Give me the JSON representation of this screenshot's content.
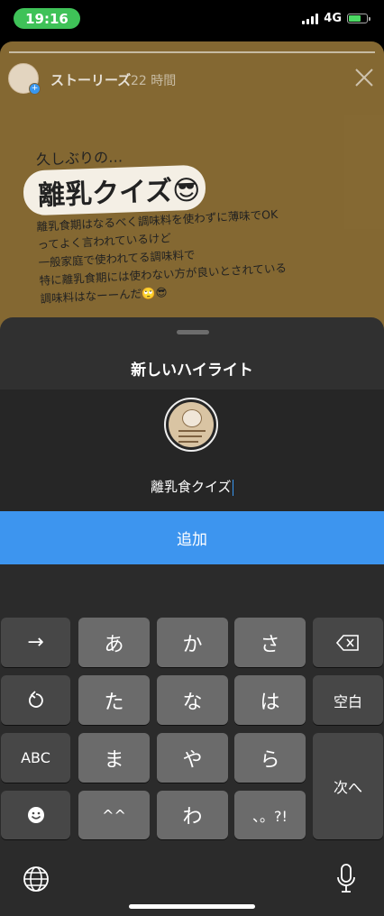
{
  "status_bar": {
    "time": "19:16",
    "network": "4G"
  },
  "story": {
    "username": "ストーリーズ",
    "time_ago": "22 時間",
    "intro": "久しぶりの…",
    "headline": "離乳クイズ😎",
    "body_lines": [
      "離乳食期はなるべく調味料を使わずに薄味でOK",
      "ってよく言われているけど",
      "一般家庭で使われてる調味料で",
      "特に離乳食期には使わない方が良いとされている",
      "調味料はなーーんだ🙄😎"
    ]
  },
  "sheet": {
    "title": "新しいハイライト",
    "name_value": "離乳食クイズ",
    "add_label": "追加"
  },
  "keyboard": {
    "row1": [
      "→",
      "あ",
      "か",
      "さ",
      "⌫"
    ],
    "row2": [
      "↺",
      "た",
      "な",
      "は",
      "空白"
    ],
    "row3": [
      "ABC",
      "ま",
      "や",
      "ら",
      "次へ"
    ],
    "row4": [
      "☻",
      "^^",
      "わ",
      "、。?!"
    ]
  }
}
